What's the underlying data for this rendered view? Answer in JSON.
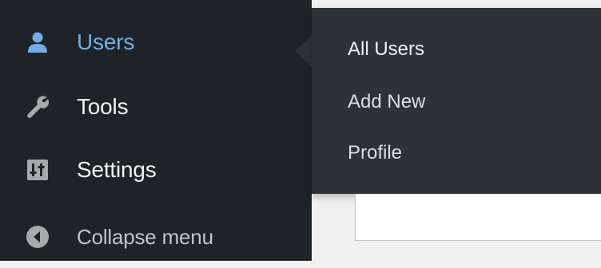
{
  "sidebar": {
    "items": [
      {
        "label": "Users",
        "icon": "user-icon"
      },
      {
        "label": "Tools",
        "icon": "wrench-icon"
      },
      {
        "label": "Settings",
        "icon": "settings-sliders-icon"
      }
    ],
    "collapse_label": "Collapse menu",
    "collapse_icon": "collapse-arrow-icon"
  },
  "submenu": {
    "items": [
      "All Users",
      "Add New",
      "Profile"
    ]
  },
  "colors": {
    "sidebar_bg": "#1d2327",
    "submenu_bg": "#2c3338",
    "current_accent": "#72aee6",
    "page_bg": "#f0f0f1"
  }
}
